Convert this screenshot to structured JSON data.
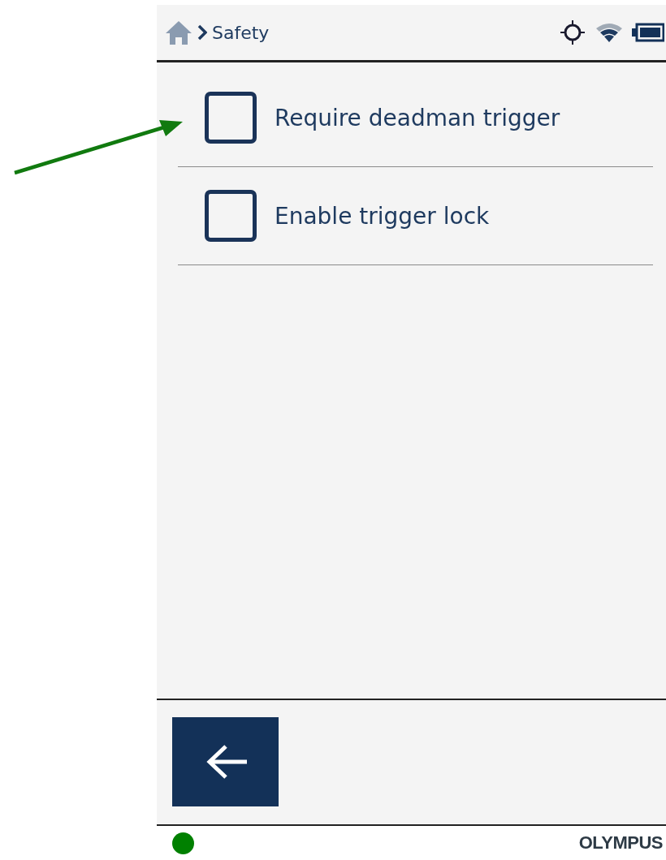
{
  "header": {
    "breadcrumb": "Safety"
  },
  "options": [
    {
      "label": "Require deadman trigger",
      "checked": false
    },
    {
      "label": "Enable trigger lock",
      "checked": false
    }
  ],
  "footer": {
    "status_light": {
      "color": "#008000"
    },
    "brand": "OLYMPUS"
  }
}
